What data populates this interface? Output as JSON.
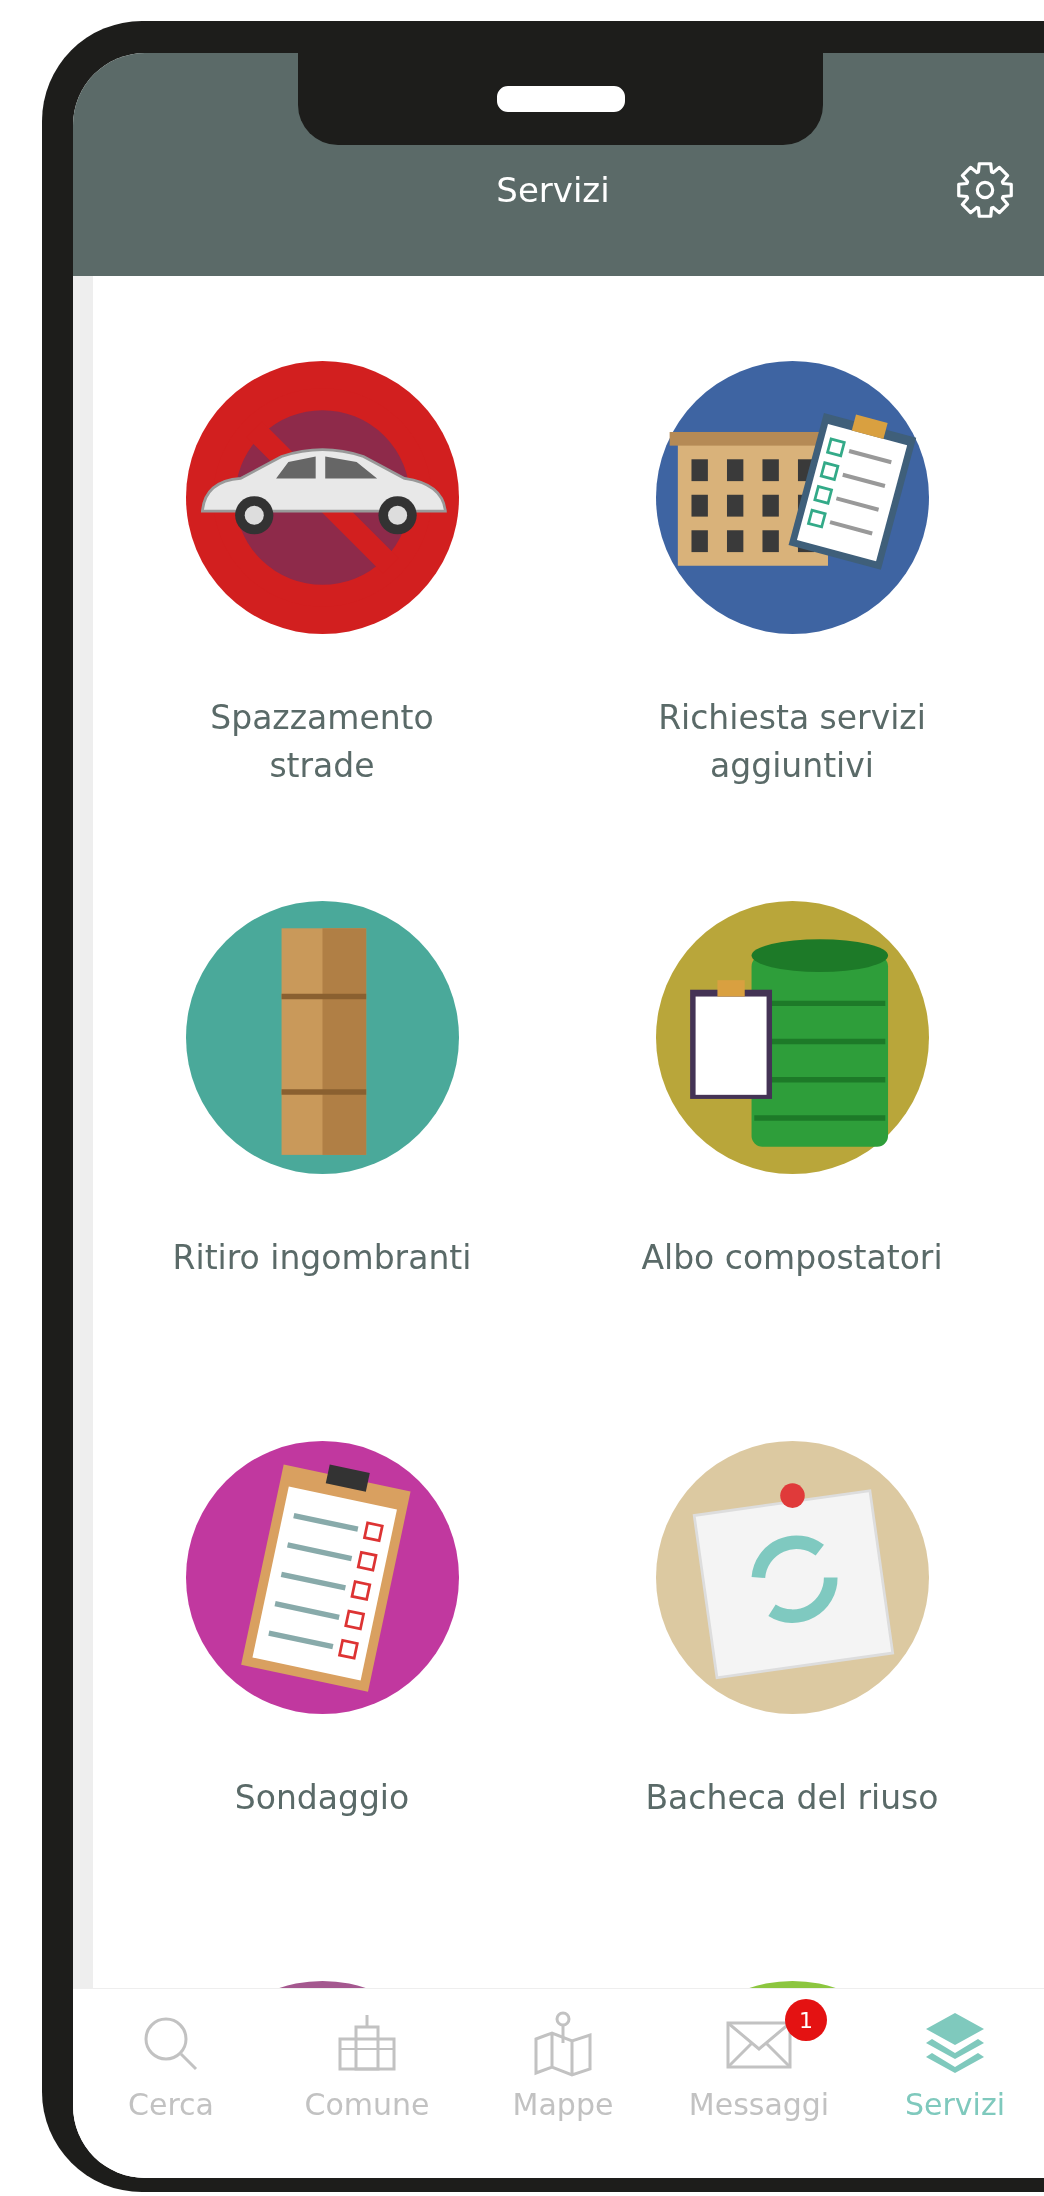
{
  "header": {
    "title": "Servizi"
  },
  "services": [
    {
      "label": "Spazzamento strade",
      "kind": "no-parking",
      "color": "#d21f1f"
    },
    {
      "label": "Richiesta servizi aggiuntivi",
      "kind": "building",
      "color": "#3e64a2"
    },
    {
      "label": "Ritiro ingombranti",
      "kind": "box",
      "color": "#4aa99a"
    },
    {
      "label": "Albo compostatori",
      "kind": "composter",
      "color": "#b9a63a"
    },
    {
      "label": "Sondaggio",
      "kind": "survey",
      "color": "#c1389f"
    },
    {
      "label": "Bacheca del riuso",
      "kind": "reuse",
      "color": "#dcc9a1"
    },
    {
      "kind": "partial",
      "color": "#a4588f"
    },
    {
      "kind": "partial",
      "color": "#8cc63f"
    }
  ],
  "nav": [
    {
      "label": "Cerca",
      "kind": "search",
      "selected": false
    },
    {
      "label": "Comune",
      "kind": "townhall",
      "selected": false
    },
    {
      "label": "Mappe",
      "kind": "map",
      "selected": false
    },
    {
      "label": "Messaggi",
      "kind": "mail",
      "selected": false,
      "badge": "1"
    },
    {
      "label": "Servizi",
      "kind": "layers",
      "selected": true
    }
  ]
}
